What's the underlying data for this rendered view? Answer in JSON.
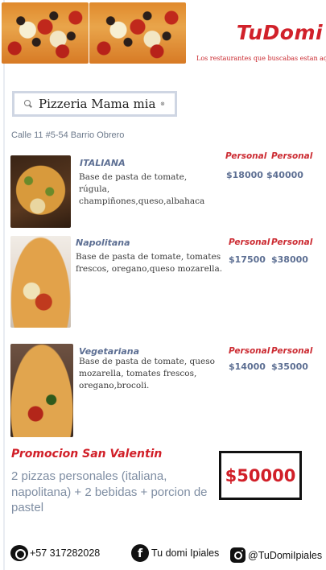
{
  "header": {
    "brand": "TuDomi",
    "tagline": "Los restaurantes que buscabas estan aqui"
  },
  "search": {
    "value": "Pizzeria Mama mia"
  },
  "restaurant": {
    "address": "Calle 11  #5-54 Barrio Obrero"
  },
  "menu": [
    {
      "name": "ITALIANA",
      "description": "Base de pasta de tomate, rúgula, champiñones,queso,albahaca",
      "size_1": "Personal",
      "size_2": "Personal",
      "price_1": "$18000",
      "price_2": "$40000"
    },
    {
      "name": "Napolitana",
      "description": "Base de pasta de tomate, tomates frescos, oregano,queso mozarella.",
      "size_1": "Personal",
      "size_2": "Personal",
      "price_1": "$17500",
      "price_2": "$38000"
    },
    {
      "name": "Vegetariana",
      "description": "Base de pasta de tomate, queso mozarella, tomates frescos, oregano,brocoli.",
      "size_1": "Personal",
      "size_2": "Personal",
      "price_1": "$14000",
      "price_2": "$35000"
    }
  ],
  "promo": {
    "title": "Promocion San Valentin",
    "description": "2 pizzas personales (italiana, napolitana) + 2 bebidas + porcion de pastel",
    "price": "$50000"
  },
  "footer": {
    "phone": "+57 317282028",
    "facebook": "Tu domi Ipiales",
    "instagram": "@TuDomiIpiales"
  },
  "colors": {
    "brand_red": "#d11f28",
    "accent_slate": "#5d6f93",
    "muted_text": "#7f8ea3"
  }
}
